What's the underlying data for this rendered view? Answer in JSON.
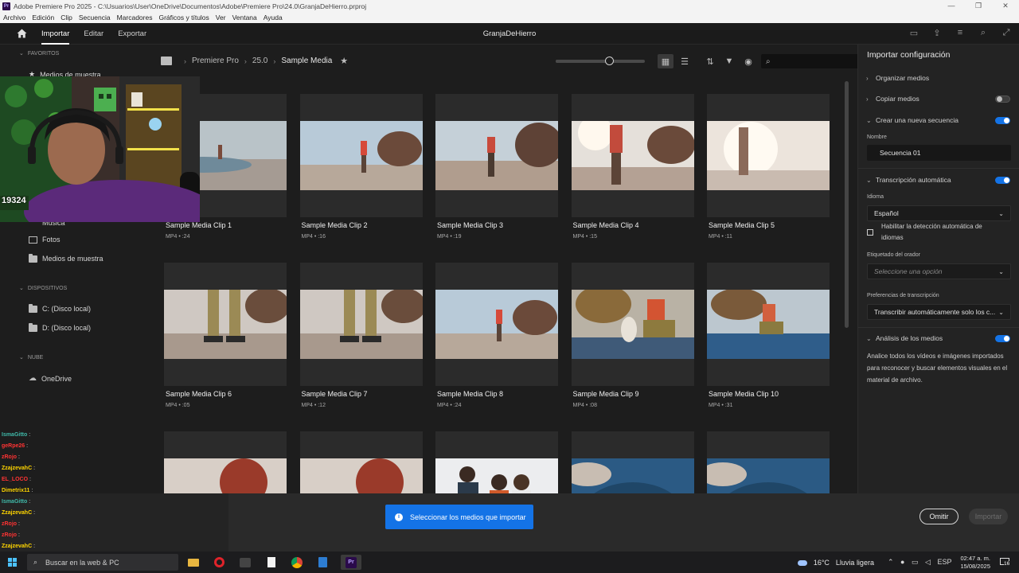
{
  "window": {
    "title": "Adobe Premiere Pro 2025 - C:\\Usuarios\\User\\OneDrive\\Documentos\\Adobe\\Premiere Pro\\24.0\\GranjaDeHierro.prproj",
    "app_icon_text": "Pr",
    "minimize": "—",
    "maximize": "❐",
    "close": "✕"
  },
  "menu": [
    "Archivo",
    "Edición",
    "Clip",
    "Secuencia",
    "Marcadores",
    "Gráficos y títulos",
    "Ver",
    "Ventana",
    "Ayuda"
  ],
  "header": {
    "tabs": [
      "Importar",
      "Editar",
      "Exportar"
    ],
    "active_tab": 0,
    "project_name": "GranjaDeHierro"
  },
  "sidebar": {
    "favorites_label": "FAVORITOS",
    "favorite_items": [
      "Medios de muestra"
    ],
    "local_items": [
      "Fotos",
      "Medios de muestra"
    ],
    "partial_item": "Música",
    "devices_label": "DISPOSITIVOS",
    "device_items": [
      "C: (Disco local)",
      "D: (Disco local)"
    ],
    "cloud_label": "NUBE",
    "cloud_items": [
      "OneDrive"
    ]
  },
  "breadcrumb": [
    "Premiere Pro",
    "25.0",
    "Sample Media"
  ],
  "browser": {
    "zoom_level": 0.6,
    "view_mode": "grid",
    "search_placeholder": ""
  },
  "clips": [
    {
      "name": "Sample Media Clip 1",
      "meta": "MP4 • :24",
      "scene": "skate-bowl"
    },
    {
      "name": "Sample Media Clip 2",
      "meta": "MP4 • :16",
      "scene": "skater-red"
    },
    {
      "name": "Sample Media Clip 3",
      "meta": "MP4 • :19",
      "scene": "skater-walk"
    },
    {
      "name": "Sample Media Clip 4",
      "meta": "MP4 • :15",
      "scene": "skater-sun"
    },
    {
      "name": "Sample Media Clip 5",
      "meta": "MP4 • :11",
      "scene": "sunflare"
    },
    {
      "name": "Sample Media Clip 6",
      "meta": "MP4 • :05",
      "scene": "legs"
    },
    {
      "name": "Sample Media Clip 7",
      "meta": "MP4 • :12",
      "scene": "legs"
    },
    {
      "name": "Sample Media Clip 8",
      "meta": "MP4 • :24",
      "scene": "skater-red"
    },
    {
      "name": "Sample Media Clip 9",
      "meta": "MP4 • :08",
      "scene": "sitting"
    },
    {
      "name": "Sample Media Clip 10",
      "meta": "MP4 • :31",
      "scene": "sitting-blue"
    },
    {
      "name": "",
      "meta": "",
      "scene": "portrait-red"
    },
    {
      "name": "",
      "meta": "",
      "scene": "portrait-red"
    },
    {
      "name": "",
      "meta": "",
      "scene": "group"
    },
    {
      "name": "",
      "meta": "",
      "scene": "bowl-blue"
    },
    {
      "name": "",
      "meta": "",
      "scene": "bowl-blue"
    }
  ],
  "import_panel": {
    "title": "Importar configuración",
    "organize_label": "Organizar medios",
    "copy_label": "Copiar medios",
    "copy_on": false,
    "new_sequence_label": "Crear una nueva secuencia",
    "new_sequence_on": true,
    "name_label": "Nombre",
    "sequence_name": "Secuencia 01",
    "transcription_label": "Transcripción automática",
    "transcription_on": true,
    "language_label": "Idioma",
    "language_value": "Español",
    "auto_detect_label": "Habilitar la detección automática de idiomas",
    "speaker_label": "Etiquetado del orador",
    "speaker_placeholder": "Seleccione una opción",
    "prefs_label": "Preferencias de transcripción",
    "prefs_value": "Transcribir automáticamente solo los c...",
    "analysis_label": "Análisis de los medios",
    "analysis_on": true,
    "analysis_desc": "Analice todos los vídeos e imágenes importados para reconocer y buscar elementos visuales en el material de archivo."
  },
  "actions": {
    "message": "Seleccionar los medios que importar",
    "skip": "Omitir",
    "import": "Importar"
  },
  "overlay": {
    "webcam_badge": "19324",
    "chat": [
      {
        "user": "IsmaGitto",
        "color": "#3fb8a8"
      },
      {
        "user": "geRpe26",
        "color": "#ff3333"
      },
      {
        "user": "zRojo",
        "color": "#ff3333"
      },
      {
        "user": "ZzajzevahC",
        "color": "#ffd500"
      },
      {
        "user": "EL_LOCO",
        "color": "#ff3333"
      },
      {
        "user": "Dimetrix11",
        "color": "#ffd500"
      },
      {
        "user": "IsmaGitto",
        "color": "#3fb8a8"
      },
      {
        "user": "ZzajzevahC",
        "color": "#ffd500"
      },
      {
        "user": "zRojo",
        "color": "#ff3333"
      },
      {
        "user": "zRojo",
        "color": "#ff3333"
      },
      {
        "user": "ZzajzevahC",
        "color": "#ffd500"
      }
    ]
  },
  "taskbar": {
    "search_placeholder": "Buscar en la web & PC",
    "weather_temp": "16°C",
    "weather_desc": "Lluvia ligera",
    "language": "ESP",
    "time": "02:47 a. m.",
    "date": "15/08/2025",
    "notification_count": "16"
  },
  "colors": {
    "accent": "#1473e6",
    "background": "#1d1d1d",
    "panel": "#232323",
    "card": "#2b2b2b"
  }
}
